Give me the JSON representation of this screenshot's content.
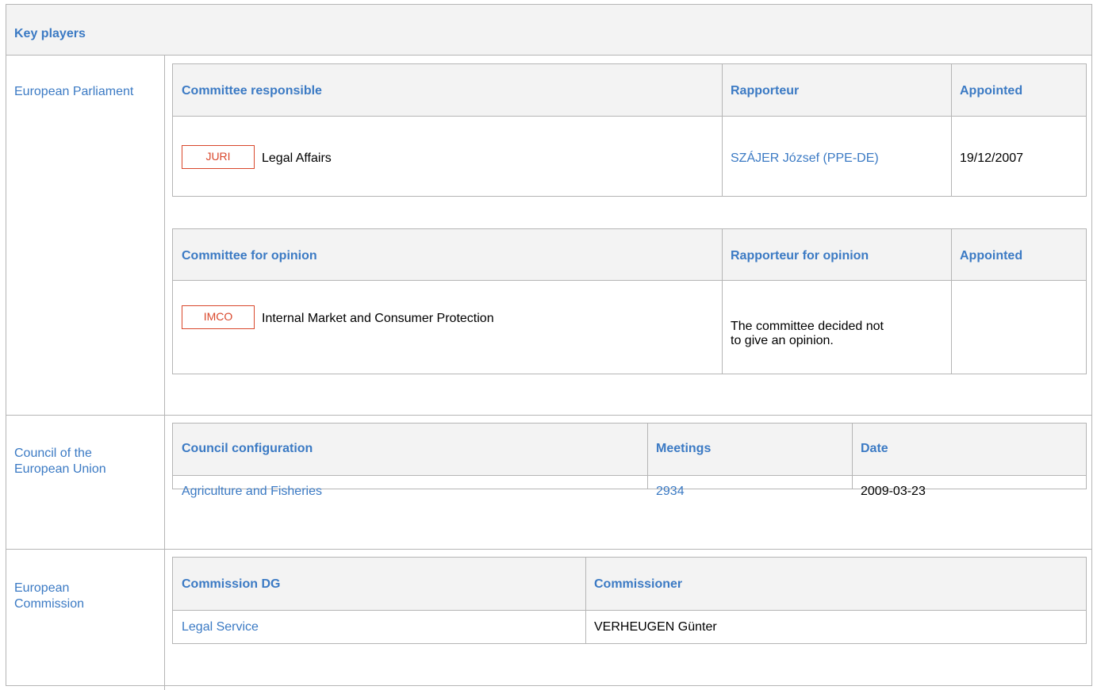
{
  "key_players": {
    "title": "Key players"
  },
  "parliament": {
    "label": "European Parliament",
    "responsible": {
      "headers": [
        "Committee responsible",
        "Rapporteur",
        "Appointed"
      ],
      "row": {
        "badge": "JURI",
        "committee": "Legal Affairs",
        "rapporteur": "SZÁJER József (PPE-DE)",
        "appointed": "19/12/2007"
      }
    },
    "opinion": {
      "headers": [
        "Committee for opinion",
        "Rapporteur for opinion",
        "Appointed"
      ],
      "row": {
        "badge": "IMCO",
        "committee": "Internal Market and Consumer Protection",
        "rapporteur_line1": "The committee decided not",
        "rapporteur_line2": "to give an opinion.",
        "appointed": ""
      }
    }
  },
  "council": {
    "label_line1": "Council of the",
    "label_line2": "European Union",
    "headers": [
      "Council configuration",
      "Meetings",
      "Date"
    ],
    "row": {
      "configuration": "Agriculture and Fisheries",
      "meeting": "2934",
      "date": "2009-03-23"
    }
  },
  "commission": {
    "label_line1": "European",
    "label_line2": "Commission",
    "headers": [
      "Commission DG",
      "Commissioner"
    ],
    "row": {
      "dg": "Legal Service",
      "commissioner": "VERHEUGEN Günter"
    }
  },
  "colors": {
    "link": "#3b7ac4",
    "badge": "#d9472b",
    "header_bg": "#f3f3f3",
    "border": "#b5b5b5"
  }
}
